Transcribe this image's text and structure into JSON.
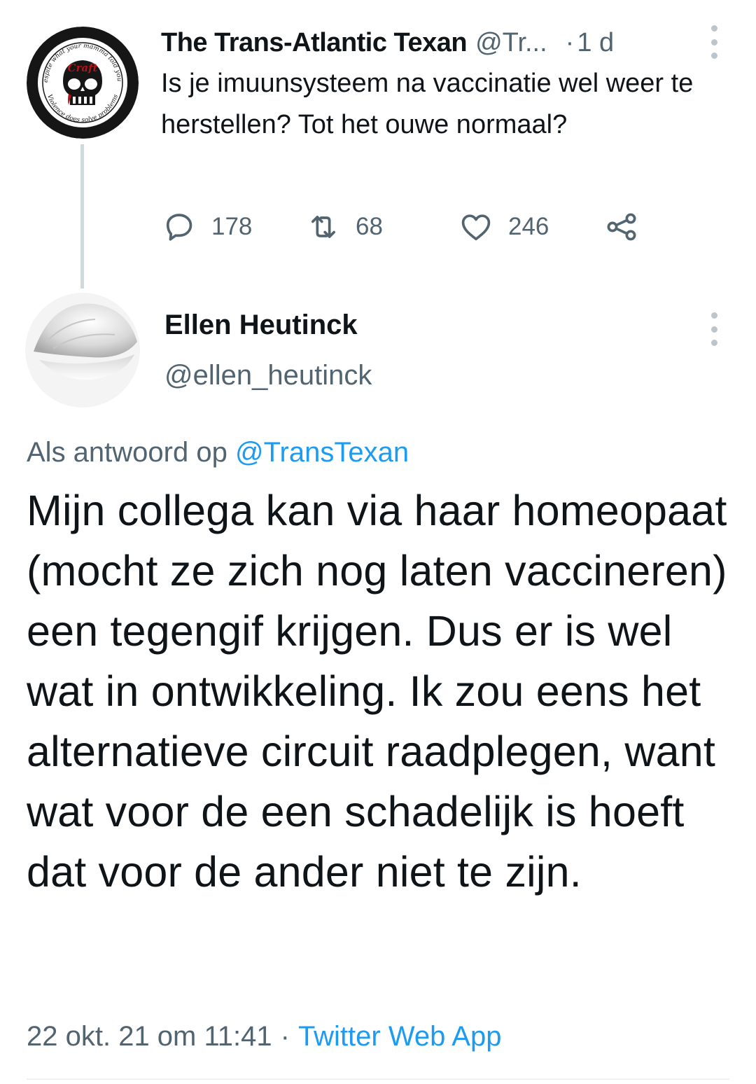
{
  "parent_tweet": {
    "display_name": "The Trans-Atlantic Texan",
    "handle": "@Tr...",
    "separator": "·",
    "time": "1 d",
    "text": "Is je imuunsysteem na vaccinatie wel weer te herstellen? Tot het ouwe normaal?",
    "avatar_text": {
      "top": "Despite what your mamma told you...",
      "center": "Craft",
      "bottom": "Violence does solve problems"
    },
    "counts": {
      "replies": "178",
      "retweets": "68",
      "likes": "246"
    },
    "icons": [
      "reply-icon",
      "retweet-icon",
      "like-icon",
      "share-icon",
      "more-icon"
    ]
  },
  "reply_tweet": {
    "display_name": "Ellen Heutinck",
    "handle": "@ellen_heutinck",
    "replying_prefix": "Als antwoord op",
    "replying_to": "@TransTexan",
    "text": "Mijn collega kan via haar homeopaat (mocht ze zich nog laten vaccineren) een tegengif krijgen. Dus er is wel wat in ontwikkeling. Ik zou eens het alternatieve circuit raadplegen, want wat voor de een schadelijk is hoeft dat voor de ander niet te zijn.",
    "timestamp": "22 okt. 21 om 11:41",
    "separator": "·",
    "source": "Twitter Web App"
  },
  "colors": {
    "text": "#0f1419",
    "secondary": "#536471",
    "link": "#1d9bf0",
    "thread_line": "#cfd9de"
  }
}
